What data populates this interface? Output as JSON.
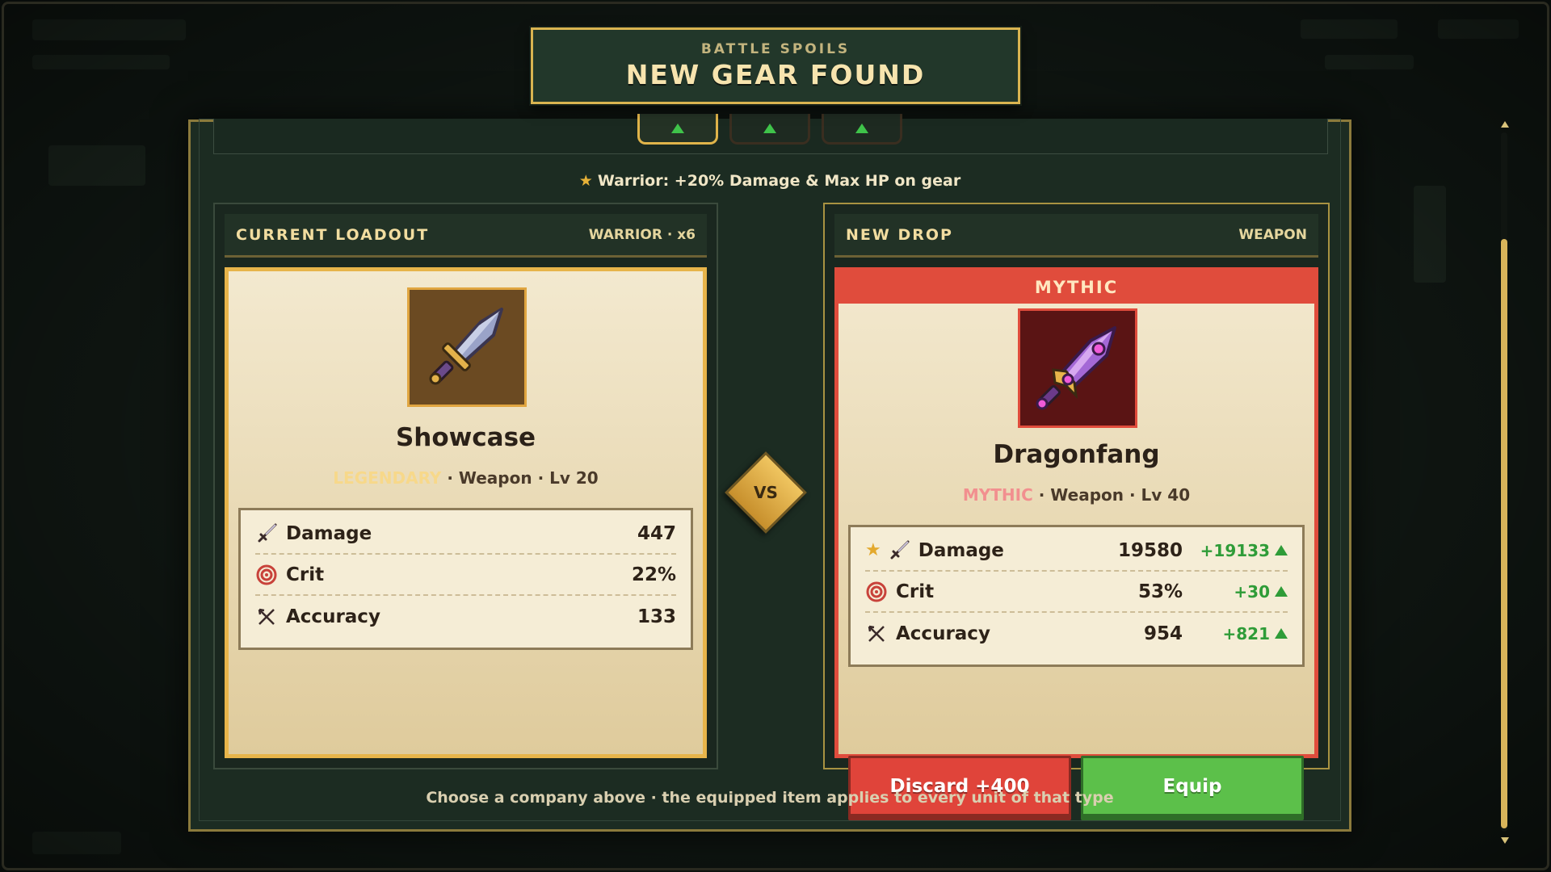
{
  "header": {
    "subtitle": "BATTLE SPOILS",
    "title": "NEW GEAR FOUND"
  },
  "class_bonus": "Warrior: +20% Damage & Max HP on gear",
  "current": {
    "panel_title": "CURRENT LOADOUT",
    "panel_meta": "WARRIOR · x6",
    "item_name": "Showcase",
    "rarity": "LEGENDARY",
    "subtitle_rest": " · Weapon · Lv 20",
    "icon": "steel-sword-icon",
    "stats": [
      {
        "label": "Damage",
        "value": "447",
        "icon": "sword-icon"
      },
      {
        "label": "Crit",
        "value": "22%",
        "icon": "target-icon"
      },
      {
        "label": "Accuracy",
        "value": "133",
        "icon": "crossed-arrows-icon"
      }
    ]
  },
  "vs_label": "VS",
  "new_drop": {
    "panel_title": "NEW DROP",
    "panel_meta": "WEAPON",
    "rarity_banner": "MYTHIC",
    "item_name": "Dragonfang",
    "rarity": "MYTHIC",
    "subtitle_rest": " · Weapon · Lv 40",
    "icon": "mythic-sword-icon",
    "stats": [
      {
        "label": "Damage",
        "value": "19580",
        "delta": "+19133",
        "icon": "sword-icon",
        "starred": true
      },
      {
        "label": "Crit",
        "value": "53%",
        "delta": "+30",
        "icon": "target-icon"
      },
      {
        "label": "Accuracy",
        "value": "954",
        "delta": "+821",
        "icon": "crossed-arrows-icon"
      }
    ],
    "discard_label": "Discard +400",
    "equip_label": "Equip"
  },
  "footer": "Choose a company above · the equipped item applies to every unit of that type",
  "colors": {
    "legendary": "#e7b44a",
    "mythic": "#e04c3c",
    "positive": "#2f9c38",
    "equip": "#5cc04a",
    "discard": "#e0443a"
  }
}
